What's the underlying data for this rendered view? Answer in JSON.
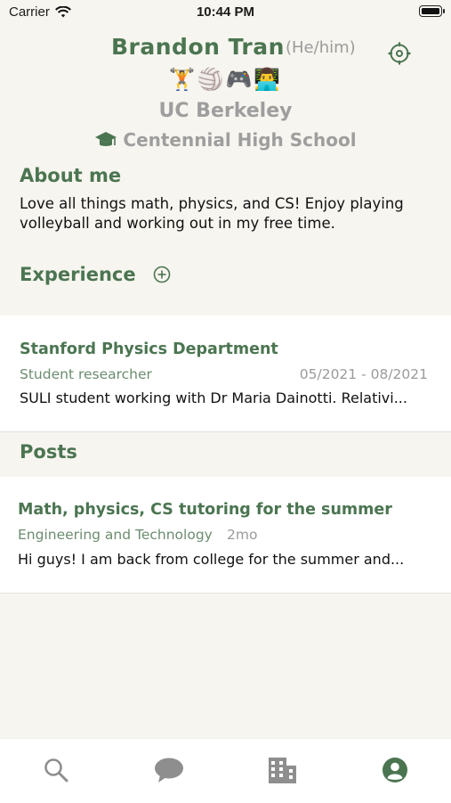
{
  "status_bar": {
    "carrier": "Carrier",
    "time": "10:44 PM"
  },
  "profile": {
    "name": "Brandon Tran",
    "pronouns": "(He/him)",
    "emojis": "🏋️🏐🎮👨‍💻",
    "school": "UC Berkeley",
    "high_school": "Centennial High School"
  },
  "about": {
    "title": "About me",
    "text": "Love all things math, physics, and CS! Enjoy playing volleyball and working out in my free time."
  },
  "experience": {
    "title": "Experience",
    "items": [
      {
        "org": "Stanford Physics Department",
        "role": "Student researcher",
        "dates": "05/2021 - 08/2021",
        "description": "SULI student working with Dr Maria Dainotti. Relativi..."
      }
    ]
  },
  "posts": {
    "title": "Posts",
    "items": [
      {
        "title": "Math, physics, CS tutoring for the summer",
        "category": "Engineering and Technology",
        "age": "2mo",
        "preview": "Hi guys! I am back from college for the summer and..."
      }
    ]
  },
  "tab_bar": {
    "tabs": [
      {
        "icon": "search-icon"
      },
      {
        "icon": "chat-bubble-icon"
      },
      {
        "icon": "building-icon"
      },
      {
        "icon": "profile-icon",
        "active": true
      }
    ]
  },
  "colors": {
    "accent": "#4b7551",
    "muted": "#9e9e9e",
    "background": "#f7f5ef",
    "card": "#ffffff"
  }
}
